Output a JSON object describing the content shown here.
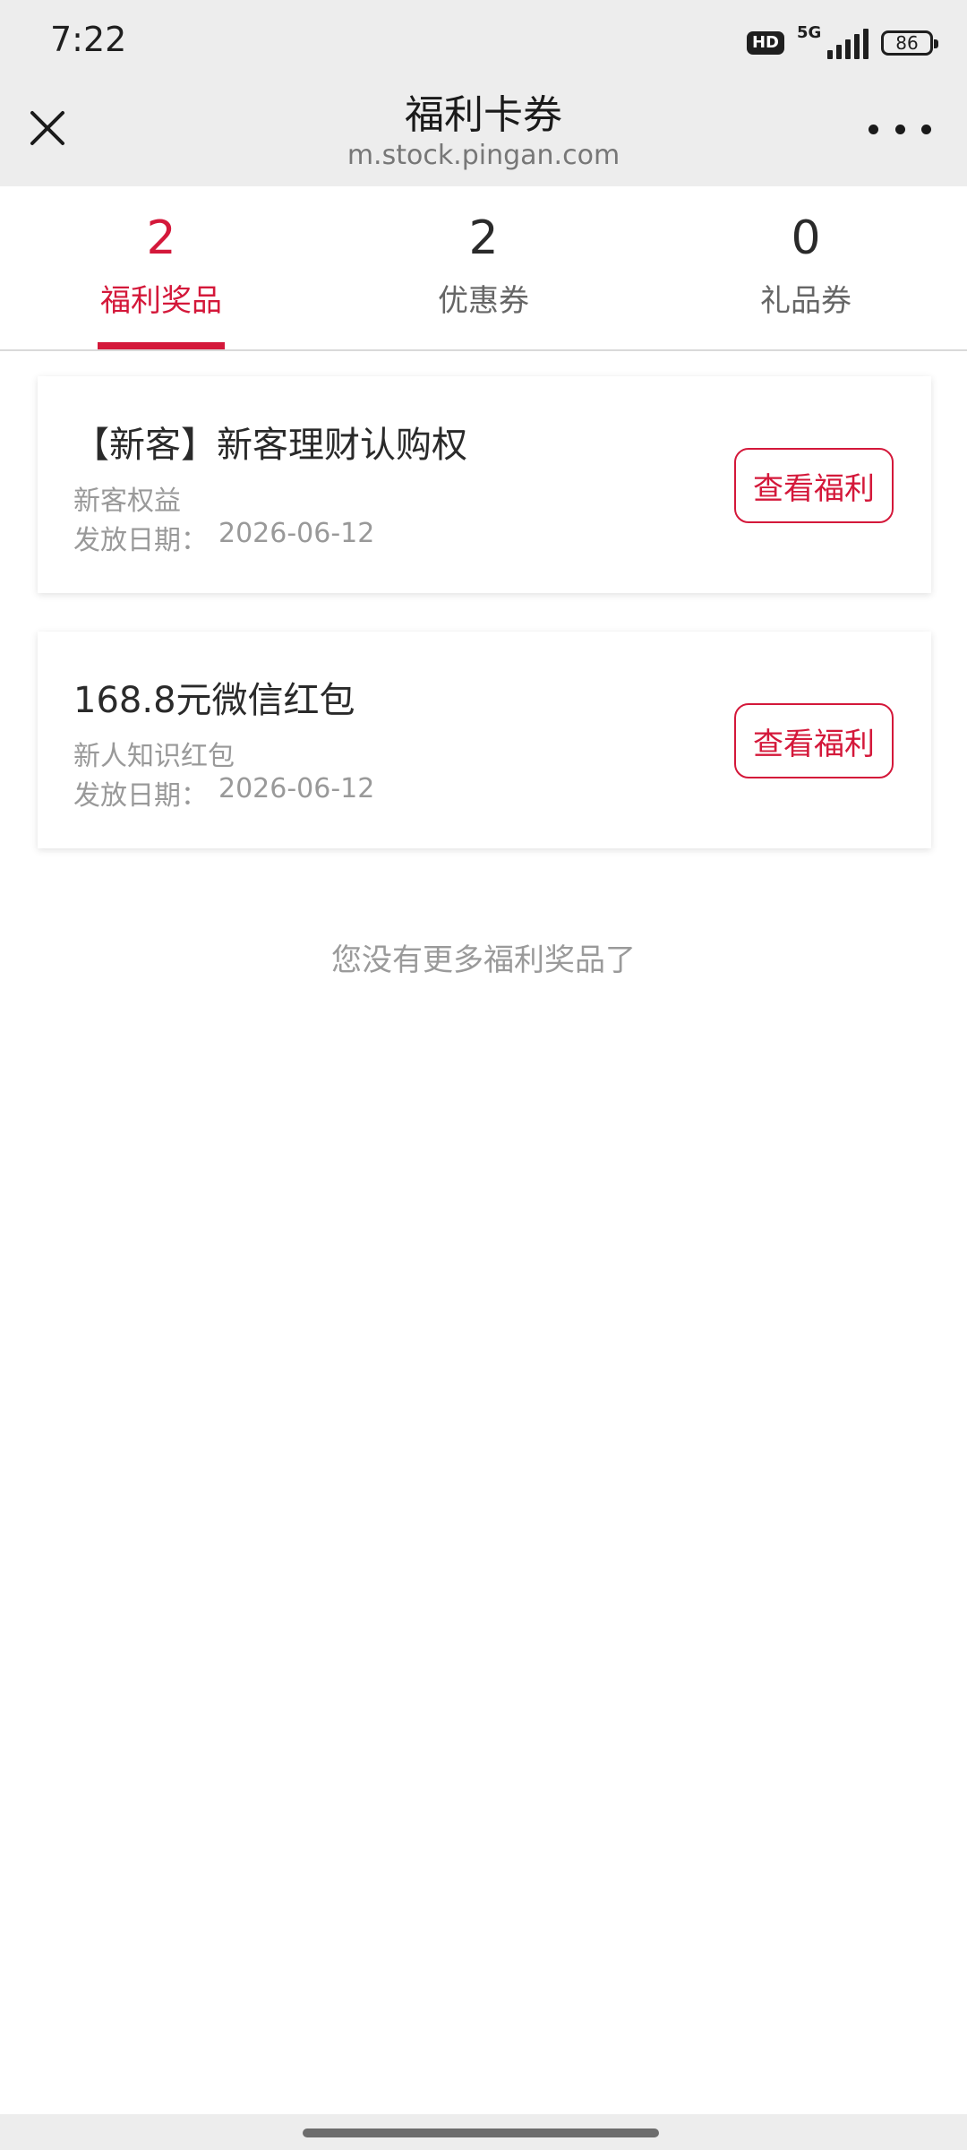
{
  "status_bar": {
    "time": "7:22",
    "hd": "HD",
    "network": "5G",
    "battery": "86",
    "icons": [
      "hd-badge",
      "signal-icon",
      "battery-icon"
    ]
  },
  "header": {
    "title": "福利卡券",
    "url": "m.stock.pingan.com",
    "icons": [
      "close-icon",
      "more-icon"
    ]
  },
  "tabs": [
    {
      "count": "2",
      "label": "福利奖品",
      "active": true
    },
    {
      "count": "2",
      "label": "优惠券",
      "active": false
    },
    {
      "count": "0",
      "label": "礼品券",
      "active": false
    }
  ],
  "cards": [
    {
      "title": "【新客】新客理财认购权",
      "subtitle": "新客权益",
      "date_label": "发放日期：",
      "date_value": "2026-06-12",
      "button": "查看福利"
    },
    {
      "title": "168.8元微信红包",
      "subtitle": "新人知识红包",
      "date_label": "发放日期：",
      "date_value": "2026-06-12",
      "button": "查看福利"
    }
  ],
  "end_text": "您没有更多福利奖品了",
  "colors": {
    "accent": "#d4183a",
    "chrome_bg": "#ededed"
  }
}
